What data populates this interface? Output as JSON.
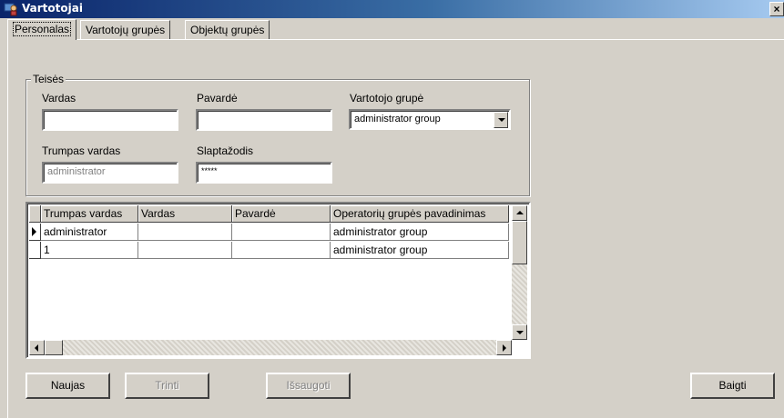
{
  "window": {
    "title": "Vartotojai",
    "close_glyph": "×",
    "icon": "users-app-icon",
    "title_bar_color": "#0a246a"
  },
  "tabs": [
    {
      "label": "Personalas",
      "active": true
    },
    {
      "label": "Vartotojų grupės",
      "active": false
    },
    {
      "label": "Objektų grupės",
      "active": false
    }
  ],
  "rights_group": {
    "legend": "Teisės",
    "vardas_label": "Vardas",
    "vardas_value": "",
    "pavarde_label": "Pavardė",
    "pavarde_value": "",
    "group_label": "Vartotojo grupė",
    "group_value": "administrator group",
    "short_name_label": "Trumpas vardas",
    "short_name_value": "administrator",
    "password_label": "Slaptažodis",
    "password_value": "*****"
  },
  "grid": {
    "columns": [
      "Trumpas vardas",
      "Vardas",
      "Pavardė",
      "Operatorių grupės pavadinimas"
    ],
    "rows": [
      {
        "current": true,
        "cells": [
          "administrator",
          "",
          "",
          "administrator group"
        ]
      },
      {
        "current": false,
        "cells": [
          "1",
          "",
          "",
          "administrator group"
        ]
      }
    ]
  },
  "buttons": {
    "new": "Naujas",
    "delete": "Trinti",
    "save": "Išsaugoti",
    "finish": "Baigti"
  }
}
